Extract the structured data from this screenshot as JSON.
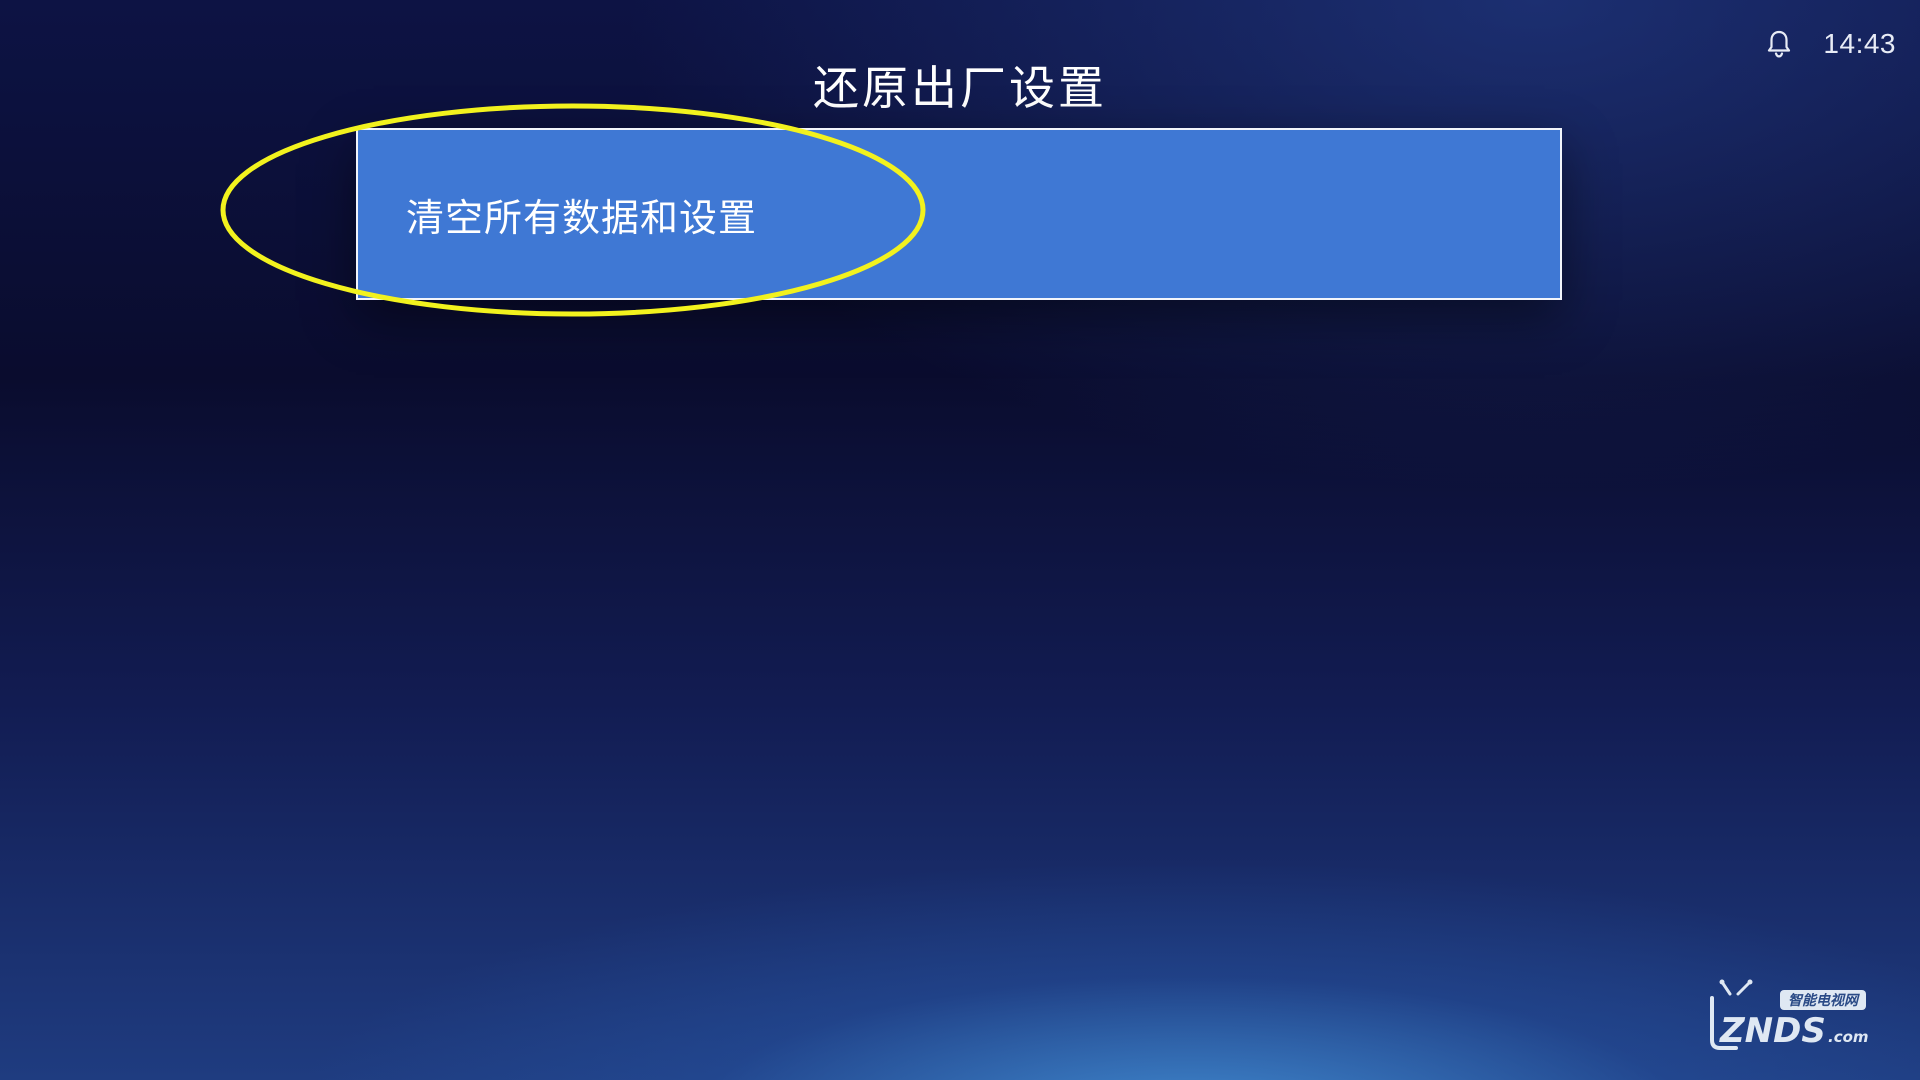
{
  "status_bar": {
    "notification_icon": "bell-icon",
    "time": "14:43"
  },
  "page": {
    "title": "还原出厂设置"
  },
  "options": [
    {
      "label": "清空所有数据和设置",
      "selected": true
    }
  ],
  "watermark": {
    "tagline": "智能电视网",
    "brand": "ZNDS",
    "domain": ".com"
  },
  "colors": {
    "selected_item_bg": "#3f78d4",
    "annotation_ellipse": "#f2f21e",
    "watermark": "#dfe8f3"
  }
}
